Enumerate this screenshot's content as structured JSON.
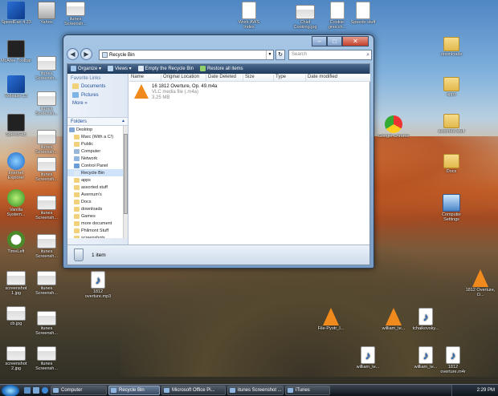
{
  "desktop": {
    "icons": [
      {
        "label": "SpeedFan 4.33",
        "kind": "blue"
      },
      {
        "label": "Yahoo",
        "kind": "gray"
      },
      {
        "label": "itunes Screensh...",
        "kind": "shot"
      },
      {
        "label": "Work AWS Index",
        "kind": "doc"
      },
      {
        "label": "Chief Cooking.jpg",
        "kind": "shot"
      },
      {
        "label": "Cookie: gnocch...",
        "kind": "doc"
      },
      {
        "label": "Speedo stuff",
        "kind": "doc"
      },
      {
        "label": "McAfee Toolbar",
        "kind": "dark"
      },
      {
        "label": "itunes Screensh...",
        "kind": "shot"
      },
      {
        "label": "downloads",
        "kind": "folder"
      },
      {
        "label": "Release 13",
        "kind": "blue"
      },
      {
        "label": "itunes Screensh...",
        "kind": "shot"
      },
      {
        "label": "apps",
        "kind": "folder"
      },
      {
        "label": "SpeedFan",
        "kind": "dark"
      },
      {
        "label": "itunes Screensh...",
        "kind": "shot"
      },
      {
        "label": "Google Chrome",
        "kind": "chrome"
      },
      {
        "label": "assorted stuff",
        "kind": "folder"
      },
      {
        "label": "Internet Explorer",
        "kind": "ie"
      },
      {
        "label": "itunes Screensh...",
        "kind": "shot"
      },
      {
        "label": "Docs",
        "kind": "folder"
      },
      {
        "label": "Vanilla System...",
        "kind": "green"
      },
      {
        "label": "itunes Screensh...",
        "kind": "shot"
      },
      {
        "label": "Computer Settings",
        "kind": "pc"
      },
      {
        "label": "TimeLeft",
        "kind": "clock"
      },
      {
        "label": "itunes Screensh...",
        "kind": "shot"
      },
      {
        "label": "screenshot 1.jpg",
        "kind": "shot"
      },
      {
        "label": "itunes Screensh...",
        "kind": "shot"
      },
      {
        "label": "1812 overture.mp3",
        "kind": "music"
      },
      {
        "label": "1812 Overture, O...",
        "kind": "cone"
      },
      {
        "label": "cb.jpg",
        "kind": "shot"
      },
      {
        "label": "itunes Screensh...",
        "kind": "shot"
      },
      {
        "label": "File-Pyotr_I...",
        "kind": "cone"
      },
      {
        "label": "william_te...",
        "kind": "cone"
      },
      {
        "label": "tchaikovsky...",
        "kind": "music"
      },
      {
        "label": "screenshot 2.jpg",
        "kind": "shot"
      },
      {
        "label": "itunes Screensh...",
        "kind": "shot"
      },
      {
        "label": "william_te...",
        "kind": "music"
      },
      {
        "label": "william_te...",
        "kind": "music"
      },
      {
        "label": "1812 overture.m4r",
        "kind": "music"
      }
    ]
  },
  "window": {
    "address": "Recycle Bin",
    "search_placeholder": "Search",
    "toolbar": {
      "organize": "Organize",
      "views": "Views",
      "empty": "Empty the Recycle Bin",
      "restore": "Restore all items"
    },
    "favorites_header": "Favorite Links",
    "favorites": [
      "Documents",
      "Pictures"
    ],
    "more": "More »",
    "folders_header": "Folders",
    "tree": [
      "Desktop",
      "Marc (With a C!)",
      "Public",
      "Computer",
      "Network",
      "Control Panel",
      "Recycle Bin",
      "apps",
      "assorted stuff",
      "Avernum's",
      "Docs",
      "downloads",
      "Games",
      "more document",
      "Philmont Stuff",
      "screenshots"
    ],
    "columns": [
      "Name",
      "Original Location",
      "Date Deleted",
      "Size",
      "Type",
      "Date modified"
    ],
    "file": {
      "name": "16 1812 Overture, Op. 49.m4a",
      "type": "VLC media file (.m4a)",
      "size": "3.25 MB"
    },
    "status": "1 item"
  },
  "taskbar": {
    "buttons": [
      "Computer",
      "Recycle Bin",
      "Microsoft Office Pi...",
      "itunes Screenshot ...",
      "iTunes"
    ],
    "clock": "2:29 PM"
  }
}
